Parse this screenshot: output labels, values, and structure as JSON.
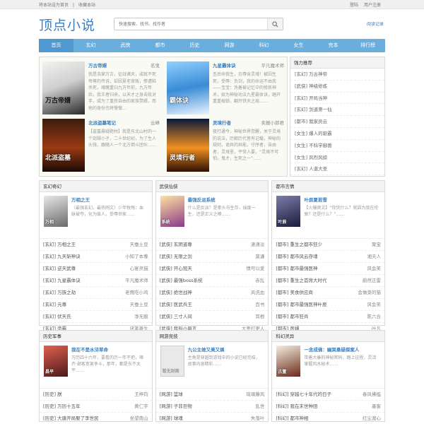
{
  "topbar": {
    "home": "将本站设为首页",
    "fav": "收藏本站",
    "login": "登陆",
    "register": "用户注册"
  },
  "header": {
    "logo": "顶点小说",
    "search_placeholder": "快速搜索、找书、找作者",
    "read_record": "阅读记录"
  },
  "nav": [
    "首页",
    "玄幻",
    "武侠",
    "都市",
    "历史",
    "网游",
    "科幻",
    "女生",
    "完本",
    "排行榜"
  ],
  "featured": [
    {
      "title": "万古帝婿",
      "author": "名鬼",
      "cover": "万古帝婿",
      "desc": "我是浩掌万古，征战诸天，成就不死帝尊的传说，却因夏老背叛，惨遭陷杀死，魂魄重归九万年前，九万年后，我王者归来，以天才之身击败对手，成为了重获自由的家族赘婿，而他的身份也将慢慢..."
    },
    {
      "title": "九星霸体诀",
      "author": "平凡魔术师",
      "cover": "霸体诀",
      "desc": "圣后命我生，忍辱含灵魂！被因生死，受辱：负剑，我的命运不由我——宝宝：凭着被记忆中的修炼神术，奴为神秘功法九星霸体诀，踏开重重枷锁，翻开铁天之局……"
    },
    {
      "title": "北派盗墓笔记",
      "author": "云峰",
      "cover": "北派盗墓",
      "desc": "【盗墓悬疑题材】我是东北山村的一个窃贼小子，二十世纪初，为了生人头钱，跟随人一个北方倒斗团伙……"
    },
    {
      "title": "灵境行者",
      "author": "卖报小郎君",
      "cover": "灵境行者",
      "desc": "夜行通今，神秘世界觉醒，关于灵境的说法，历朝历代皆有记载，神秘的规则，诡异的异能，守序者，自由者，灵境里，平常人要，“灵境不可怕，鬼才，生死之一”……"
    }
  ],
  "rank": {
    "title": "强力推荐",
    "items": [
      "[玄幻] 万古神帝",
      "[武侠] 神级修炼",
      "[玄幻] 开局当神",
      "[玄幻] 剑道第一仙",
      "[都市] 我家员云",
      "[女生] 爆人的驱霸",
      "[女生] 不科学御兽",
      "[女生] 风烈风掠",
      "[玄幻] 人道大圣"
    ]
  },
  "cats_row2": [
    {
      "title": "玄幻奇幻",
      "cover": "万相",
      "feat_title": "万相之王",
      "feat_desc": "（最强玄幻，最热网文）少年牧殇：血脉被夺，化为废人，受辱世家……",
      "items": [
        [
          "[玄幻] 万相之王",
          "天蚕土豆"
        ],
        [
          "[玄幻] 九天斩神诀",
          "小知了本尊"
        ],
        [
          "[玄幻] 逆天武尊",
          "心宴灵猫"
        ],
        [
          "[玄幻] 九星霸体诀",
          "平凡魔术师"
        ],
        [
          "[玄幻] 万族之劫",
          "老鹰吃小鸡"
        ],
        [
          "[玄幻] 元尊",
          "天蚕土豆"
        ],
        [
          "[玄幻] 伏天氏",
          "净无痕"
        ],
        [
          "[玄幻] 帝霸",
          "厌笔萧生"
        ],
        [
          "[玄幻] 九星神王诀",
          "平凡魔术师"
        ]
      ]
    },
    {
      "title": "武侠仙侠",
      "cover": "系统",
      "feat_title": "最强反派系统",
      "feat_desc": "什么是反派？是拳头与生存，揣度一生，还是正义之棒……",
      "items": [
        [
          "[武侠] 玄阴道尊",
          "潇潇淡"
        ],
        [
          "[武侠] 无限之剑",
          "莫谦"
        ],
        [
          "[武侠] 开心冠天",
          "情可以爱"
        ],
        [
          "[武侠] 最强boss系统",
          "赤乱"
        ],
        [
          "[武侠] 绝世战神",
          "风洗血"
        ],
        [
          "[武侠] 医武兵王",
          "百书"
        ],
        [
          "[武侠] 三寸人间",
          "耳根"
        ],
        [
          "[武侠] 我叫小眉言",
          "大枣打更人"
        ]
      ]
    },
    {
      "title": "都市言情",
      "cover": "叶辰",
      "feat_title": "叶辰夏若雪",
      "feat_desc": "【火爆爽文】“你凭什么？就因为我在伦敦？还是什么？”……",
      "items": [
        [
          "[都市] 重生之都市狂少",
          "聚宝"
        ],
        [
          "[都市] 都市风云存魂",
          "湘夫人"
        ],
        [
          "[都市] 都市最强医神",
          "风会笑"
        ],
        [
          "[都市] 重生之首席大时代",
          "蔚然正雷"
        ],
        [
          "[都市] 美食供应商",
          "会做菜的猫"
        ],
        [
          "[都市] 都市最强医神叶辰",
          "风会笑"
        ],
        [
          "[都市] 都市狂兵",
          "陈六合"
        ],
        [
          "[都市] 医婿",
          "叶凡"
        ]
      ]
    }
  ],
  "cats_row3": [
    {
      "title": "历史军事",
      "cover": "昌平",
      "feat_title": "我在不是水浒草命",
      "feat_desc": "万历四十六年，要看的历一年不把，楮·齐·邺客宽害争斗，那年，都是东不太平……",
      "items": [
        [
          "[历史] 朕",
          "王梓钧"
        ],
        [
          "[历史] 万历十五年",
          "黄仁宇"
        ],
        [
          "[历史] 大唐开局娶了李世民",
          "坐望南山"
        ]
      ]
    },
    {
      "title": "网游竞技",
      "cover": "暂无封面",
      "feat_title": "九公主她又美又飒",
      "feat_desc": "主角是穿越到游戏中的小说已经完结，故事内容精彩……",
      "items": [
        [
          "[网游] 篮球",
          "琉璃藤风"
        ],
        [
          "[网游] 子非巨物",
          "乱世"
        ],
        [
          "[网游] 球魂",
          "失落叶"
        ]
      ]
    },
    {
      "title": "科幻灵异",
      "cover": "古董",
      "feat_title": "一念成佛：幽冥悬疑探案人",
      "feat_desc": "带着大秦的神秘密码，踏上征程，灵活掌握风水秘术……",
      "items": [
        [
          "[科幻] 穿越七十年代的日子",
          "春风拂槛"
        ],
        [
          "[科幻] 我在末世种田",
          "墨客"
        ],
        [
          "[科幻] 都市神相",
          "红尘渡心"
        ]
      ]
    }
  ],
  "colors": {
    "brand": "#3a7fc1",
    "nav": "#6aaede",
    "nav_active": "#4f98d0"
  }
}
